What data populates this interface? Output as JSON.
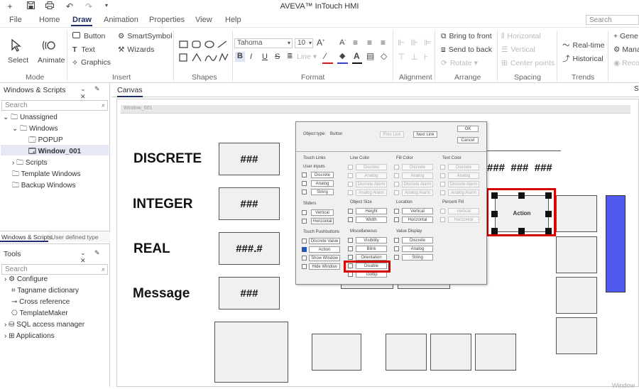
{
  "app_title": "AVEVA™ InTouch HMI",
  "menu": [
    "File",
    "Home",
    "Draw",
    "Animation",
    "Properties",
    "View",
    "Help"
  ],
  "active_menu": "Draw",
  "search_placeholder": "Search",
  "ribbon": {
    "select": "Select",
    "animate": "Animate",
    "mode_group": "Mode",
    "button": "Button",
    "smartsymbol": "SmartSymbol",
    "text": "Text",
    "wizards": "Wizards",
    "graphics": "Graphics",
    "insert_group": "Insert",
    "shapes_group": "Shapes",
    "font": "Tahoma",
    "font_size": "10",
    "line": "Line",
    "format_group": "Format",
    "alignment_group": "Alignment",
    "bring_front": "Bring to front",
    "send_back": "Send to back",
    "rotate": "Rotate",
    "arrange_group": "Arrange",
    "horizontal": "Horizontal",
    "vertical": "Vertical",
    "center_points": "Center points",
    "spacing_group": "Spacing",
    "realtime": "Real-time",
    "historical": "Historical",
    "trends_group": "Trends",
    "gen": "Gene",
    "mana": "Mana",
    "reco": "Reco"
  },
  "left_panel": {
    "title": "Windows & Scripts",
    "search": "Search",
    "tree": [
      "Unassigned",
      "Windows",
      "POPUP",
      "Window_001",
      "Scripts",
      "Template Windows",
      "Backup Windows"
    ],
    "tabs": [
      "Windows & Scripts",
      "User defined type"
    ]
  },
  "tools_panel": {
    "title": "Tools",
    "search": "Search",
    "items": [
      "Configure",
      "Tagname dictionary",
      "Cross reference",
      "TemplateMaker",
      "SQL access manager",
      "Applications"
    ]
  },
  "canvas": {
    "tab": "Canvas",
    "window_title": "Window_001",
    "labels": [
      "DISCRETE",
      "INTEGER",
      "REAL",
      "Message"
    ],
    "values": [
      "###",
      "###",
      "###.#",
      "###"
    ],
    "hash_row": "###  ###  ###",
    "action": "Action",
    "watermark": "Window"
  },
  "dialog": {
    "object_type_label": "Object type:",
    "object_type": "Button",
    "prev_link": "Prev Link",
    "next_link": "Next Link",
    "ok": "OK",
    "cancel": "Cancel",
    "touch_links": "Touch Links",
    "user_inputs": "User Inputs",
    "ui_items": [
      "Discrete",
      "Analog",
      "String"
    ],
    "sliders": "Sliders",
    "slider_items": [
      "Vertical",
      "Horizontal"
    ],
    "touch_pushbuttons": "Touch Pushbuttons",
    "pb_items": [
      "Discrete Value",
      "Action",
      "Show Window",
      "Hide Window"
    ],
    "line_color": "Line Color",
    "fill_color": "Fill Color",
    "text_color": "Text Color",
    "color_items": [
      "Discrete",
      "Analog",
      "Discrete Alarm",
      "Analog Alarm"
    ],
    "object_size": "Object Size",
    "size_items": [
      "Height",
      "Width"
    ],
    "location": "Location",
    "loc_items": [
      "Vertical",
      "Horizontal"
    ],
    "percent_fill": "Percent Fill",
    "pf_items": [
      "Vertical",
      "Horizontal"
    ],
    "miscellaneous": "Miscellaneous",
    "misc_items": [
      "Visibility",
      "Blink",
      "Orientation",
      "Disable",
      "Tooltip"
    ],
    "value_display": "Value Display",
    "vd_items": [
      "Discrete",
      "Analog",
      "String"
    ]
  }
}
